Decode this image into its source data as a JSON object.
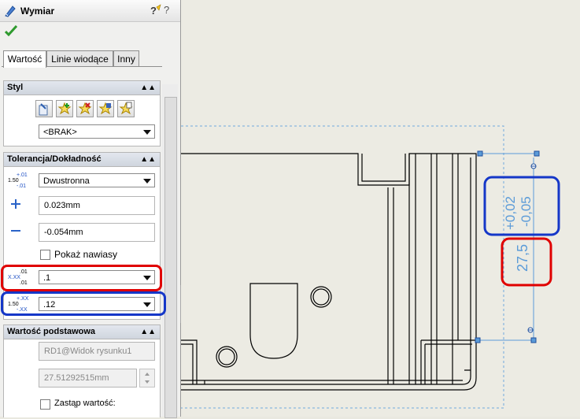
{
  "title": "Wymiar",
  "tabs": [
    "Wartość",
    "Linie wiodące",
    "Inny"
  ],
  "groups": {
    "style": {
      "title": "Styl",
      "style_select": "<BRAK>",
      "buttons": [
        "apply-default-icon",
        "add-style-icon",
        "delete-style-icon",
        "save-style-icon",
        "load-style-icon"
      ]
    },
    "tolerance": {
      "title": "Tolerancja/Dokładność",
      "type_select": "Dwustronna",
      "plus_value": "0.023mm",
      "minus_value": "-0.054mm",
      "show_parentheses_label": "Pokaż nawiasy",
      "primary_precision": ".1",
      "tolerance_precision": ".12",
      "icon_labels": {
        "type_top": "+.01",
        "type_mid": "1.50",
        "type_bot": "-.01",
        "prec_top": ".01",
        "prec_mid": "X.XX",
        "prec_bot": ".01",
        "tolprec_top": "+.XX",
        "tolprec_mid": "1.50",
        "tolprec_bot": "-.XX"
      }
    },
    "primary_value": {
      "title": "Wartość podstawowa",
      "reference": "RD1@Widok rysunku1",
      "value": "27.51292515mm",
      "override_label": "Zastąp wartość:"
    }
  },
  "drawing": {
    "dimension_value": "27,5",
    "tolerance_upper": "+0,02",
    "tolerance_lower": "-0,05"
  },
  "colors": {
    "dimension": "#5b9bd8",
    "highlight_red": "#e00000",
    "highlight_blue": "#1537c8",
    "selection_dashed": "#6fa8dc"
  }
}
